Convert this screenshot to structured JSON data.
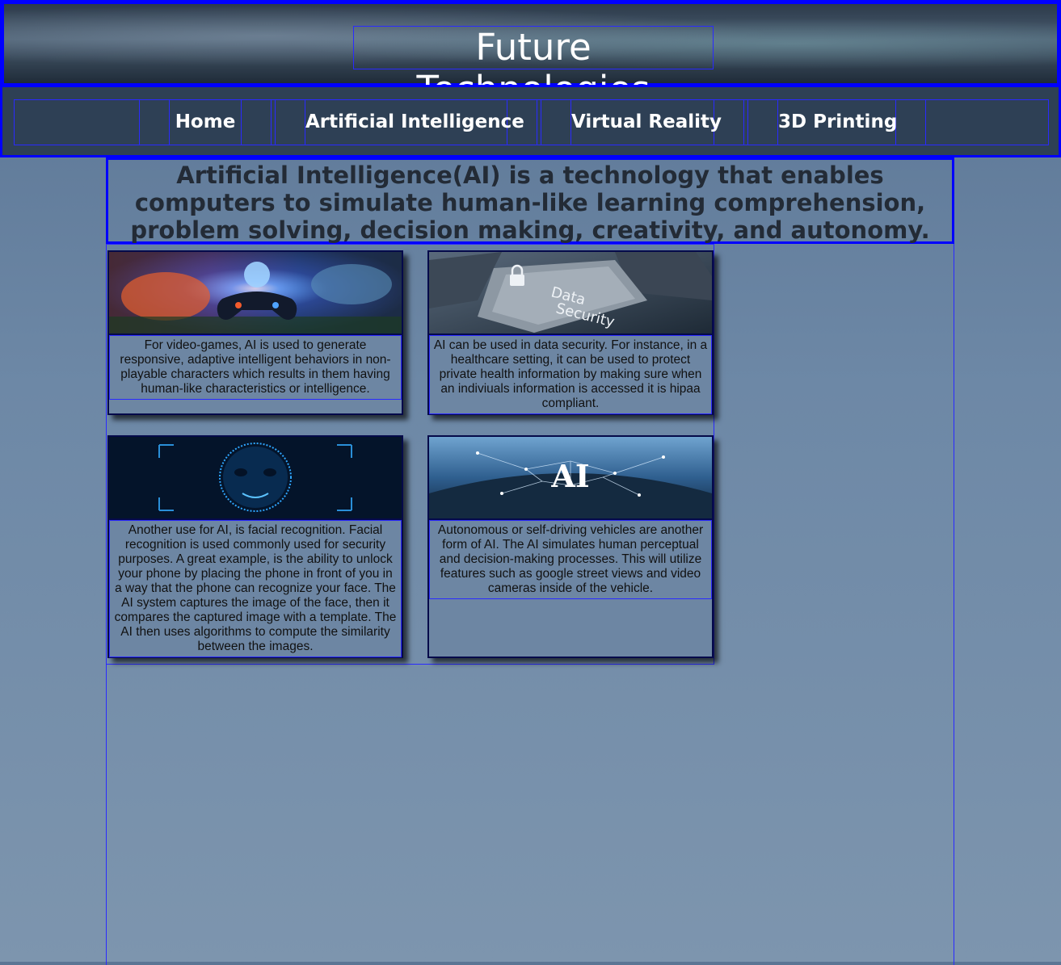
{
  "header": {
    "title": "Future Technologies"
  },
  "nav": {
    "items": [
      {
        "label": "Home"
      },
      {
        "label": "Artificial Intelligence"
      },
      {
        "label": "Virtual Reality"
      },
      {
        "label": "3D Printing"
      }
    ]
  },
  "main": {
    "intro": "Artificial Intelligence(AI) is a technology that enables computers to simulate human-like learning comprehension, problem solving, decision making, creativity, and autonomy.",
    "cards": [
      {
        "image_icon": "gaming-controller-brain-image",
        "text": "For video-games, AI is used to generate responsive, adaptive intelligent behaviors in non-playable characters which results in them having human-like characteristics or intelligence."
      },
      {
        "image_icon": "data-security-key-image",
        "image_caption_lines": [
          "Data",
          "Security"
        ],
        "text": "AI can be used in data security. For instance, in a healthcare setting, it can be used to protect private health information by making sure when an indiviuals information is accessed it is hipaa compliant."
      },
      {
        "image_icon": "facial-recognition-image",
        "text": "Another use for AI, is facial recognition. Facial recognition is used commonly used for security purposes. A great example, is the ability to unlock your phone by placing the phone in front of you in a way that the phone can recognize your face. The AI system captures the image of the face, then it compares the captured image with a template. The AI then uses algorithms to compute the similarity between the images."
      },
      {
        "image_icon": "self-driving-car-ai-image",
        "image_caption": "AI",
        "text": "Autonomous or self-driving vehicles are another form of AI. The AI simulates human perceptual and decision-making processes. This will utilize features such as google street views and video cameras inside of the vehicle."
      }
    ]
  },
  "colors": {
    "border_accent": "#0000ff",
    "nav_background": "#2e4055",
    "page_gradient_top": "#5b7594",
    "page_gradient_bottom": "#7d95ae",
    "intro_text": "#232b36"
  }
}
